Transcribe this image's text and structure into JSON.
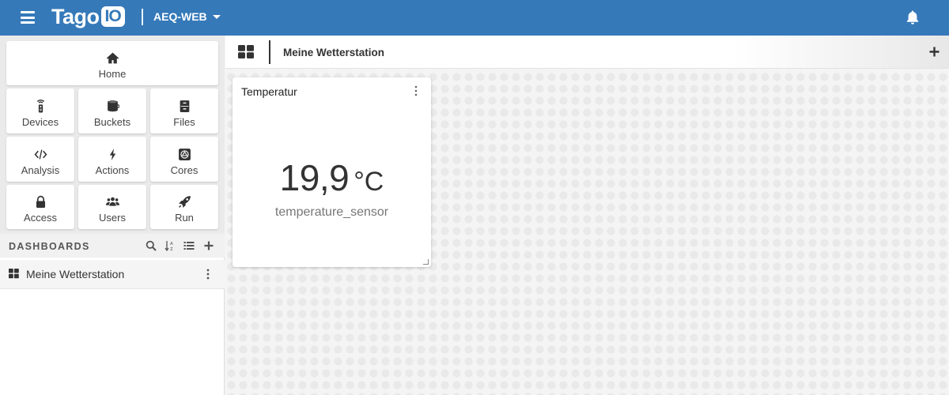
{
  "header": {
    "logo_text": "Tago",
    "logo_box_text": "IO",
    "account_name": "AEQ-WEB",
    "bell_icon": "bell-icon",
    "menu_icon": "hamburger-icon",
    "background_color": "#3579b9"
  },
  "sidebar": {
    "tiles": [
      {
        "label": "Home",
        "icon": "home-icon"
      },
      {
        "label": "Devices",
        "icon": "remote-device-icon"
      },
      {
        "label": "Buckets",
        "icon": "bucket-icon"
      },
      {
        "label": "Files",
        "icon": "file-cabinet-icon"
      },
      {
        "label": "Analysis",
        "icon": "code-icon"
      },
      {
        "label": "Actions",
        "icon": "bolt-icon"
      },
      {
        "label": "Cores",
        "icon": "cores-icon"
      },
      {
        "label": "Access",
        "icon": "lock-icon"
      },
      {
        "label": "Users",
        "icon": "users-icon"
      },
      {
        "label": "Run",
        "icon": "rocket-icon"
      }
    ],
    "dashboards": {
      "title": "DASHBOARDS",
      "tools": [
        "search-icon",
        "sort-alpha-icon",
        "list-icon",
        "plus-icon"
      ],
      "items": [
        {
          "label": "Meine Wetterstation",
          "icon": "grid-icon"
        }
      ]
    }
  },
  "main": {
    "tab": {
      "title": "Meine Wetterstation",
      "grid_icon": "grid-icon",
      "add_icon": "plus-icon"
    },
    "widgets": [
      {
        "title": "Temperatur",
        "value": "19,9",
        "unit": "°C",
        "variable": "temperature_sensor"
      }
    ]
  }
}
